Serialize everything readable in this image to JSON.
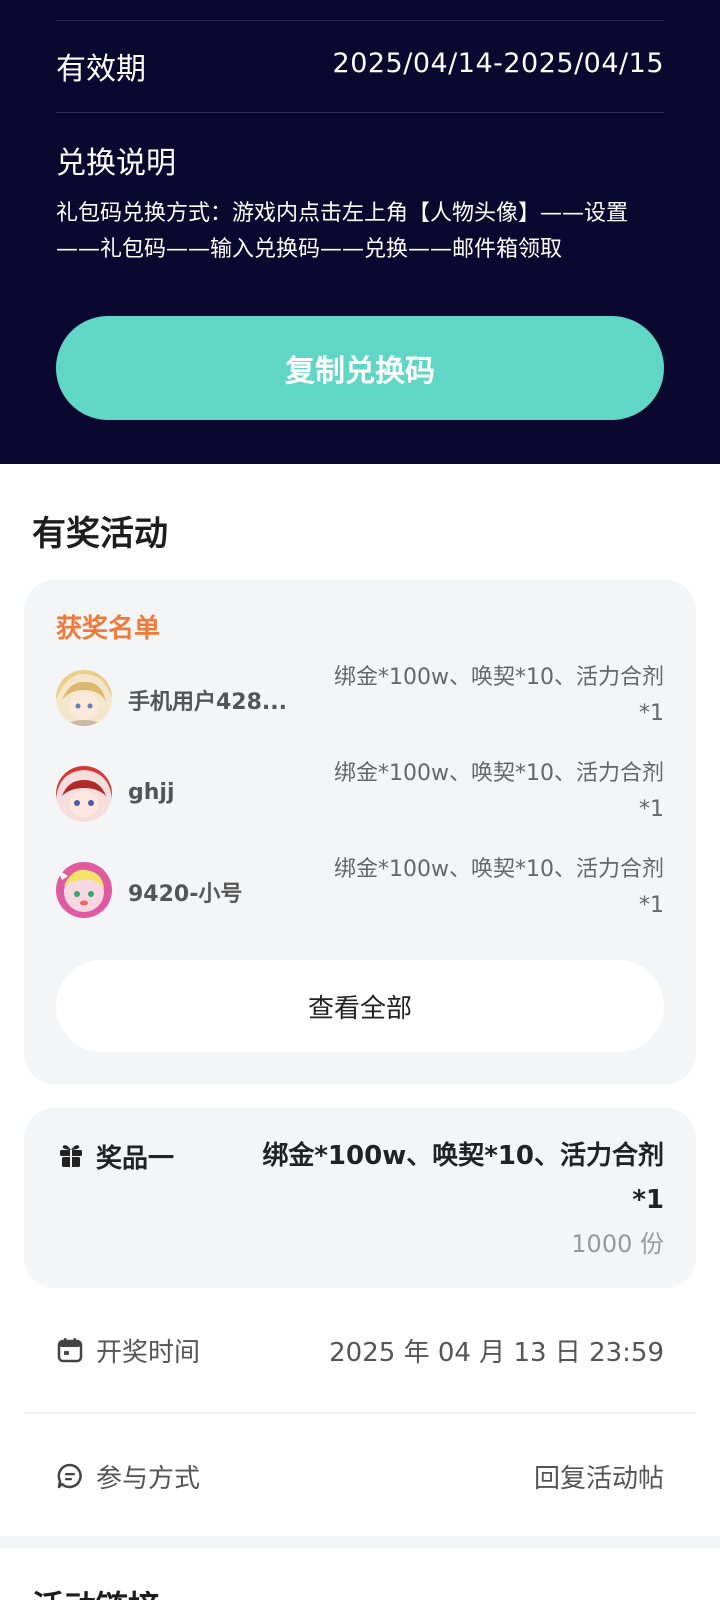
{
  "validity": {
    "label": "有效期",
    "value": "2025/04/14-2025/04/15"
  },
  "instructions": {
    "title": "兑换说明",
    "text": "礼包码兑换方式：游戏内点击左上角【人物头像】——设置——礼包码——输入兑换码——兑换——邮件箱领取"
  },
  "copy_button": {
    "label": "复制兑换码"
  },
  "section_title": "有奖活动",
  "winners": {
    "title": "获奖名单",
    "items": [
      {
        "name": "手机用户428...",
        "prize": "绑金*100w、唤契*10、活力合剂*1"
      },
      {
        "name": "ghjj",
        "prize": "绑金*100w、唤契*10、活力合剂*1"
      },
      {
        "name": "9420-小号",
        "prize": "绑金*100w、唤契*10、活力合剂*1"
      }
    ],
    "view_all_label": "查看全部"
  },
  "prize": {
    "label": "奖品一",
    "name": "绑金*100w、唤契*10、活力合剂*1",
    "count": "1000 份"
  },
  "draw_time": {
    "label": "开奖时间",
    "value": "2025 年 04 月 13 日 23:59"
  },
  "participation": {
    "label": "参与方式",
    "value": "回复活动帖"
  },
  "next_section_title": "活动链接",
  "colors": {
    "dark_bg": "#0b0830",
    "accent": "#60d7c6",
    "winners_title": "#f07a3a",
    "card_bg": "#f4f5f7"
  },
  "icons": {
    "prize": "gift-icon",
    "draw_time": "calendar-icon",
    "participation": "chat-bubble-icon"
  }
}
